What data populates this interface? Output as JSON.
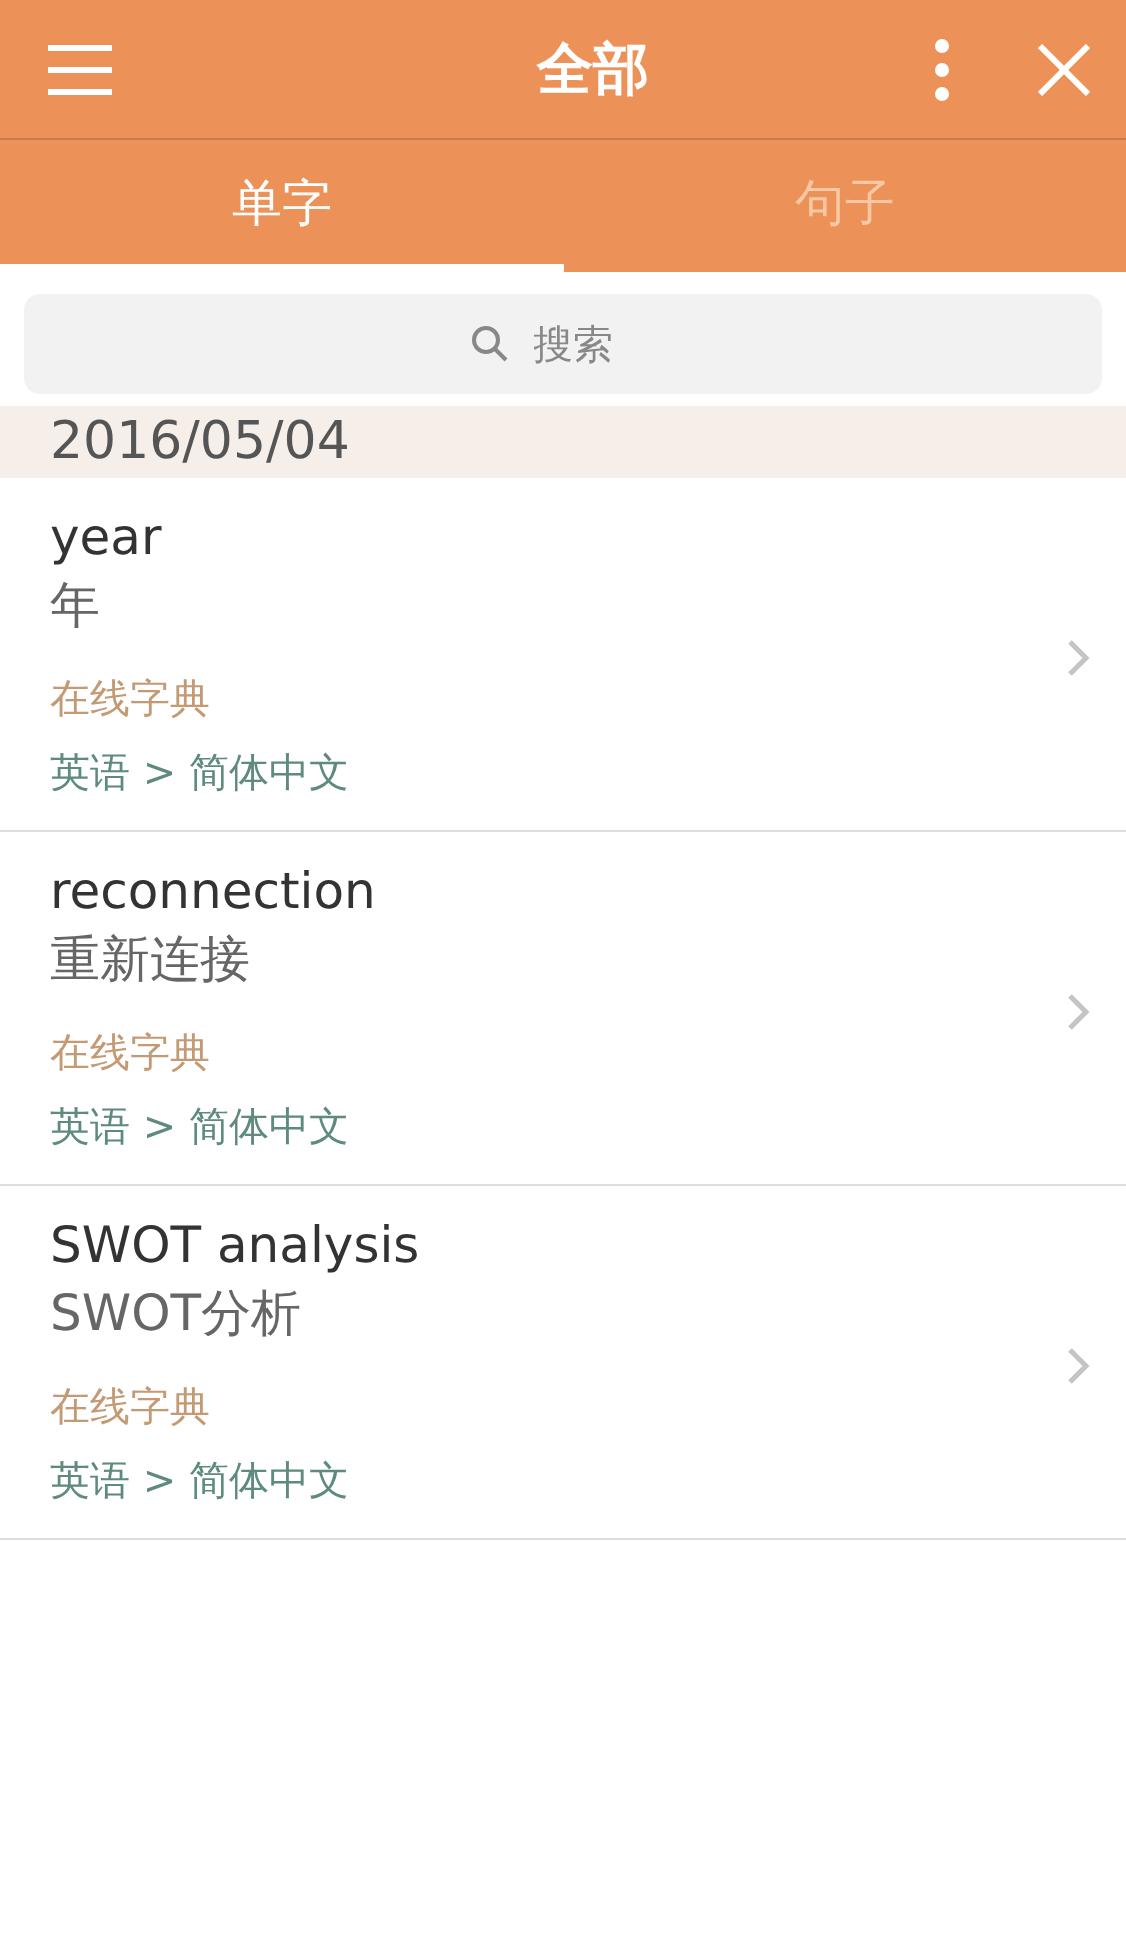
{
  "header": {
    "title": "全部"
  },
  "tabs": [
    {
      "label": "单字",
      "selected": true
    },
    {
      "label": "句子",
      "selected": false
    }
  ],
  "search": {
    "placeholder": "搜索"
  },
  "date": "2016/05/04",
  "entries": [
    {
      "word": "year",
      "translation": "年",
      "source": "在线字典",
      "languages": "英语 > 简体中文"
    },
    {
      "word": "reconnection",
      "translation": "重新连接",
      "source": "在线字典",
      "languages": "英语 > 简体中文"
    },
    {
      "word": "SWOT analysis",
      "translation": "SWOT分析",
      "source": "在线字典",
      "languages": "英语 > 简体中文"
    }
  ]
}
